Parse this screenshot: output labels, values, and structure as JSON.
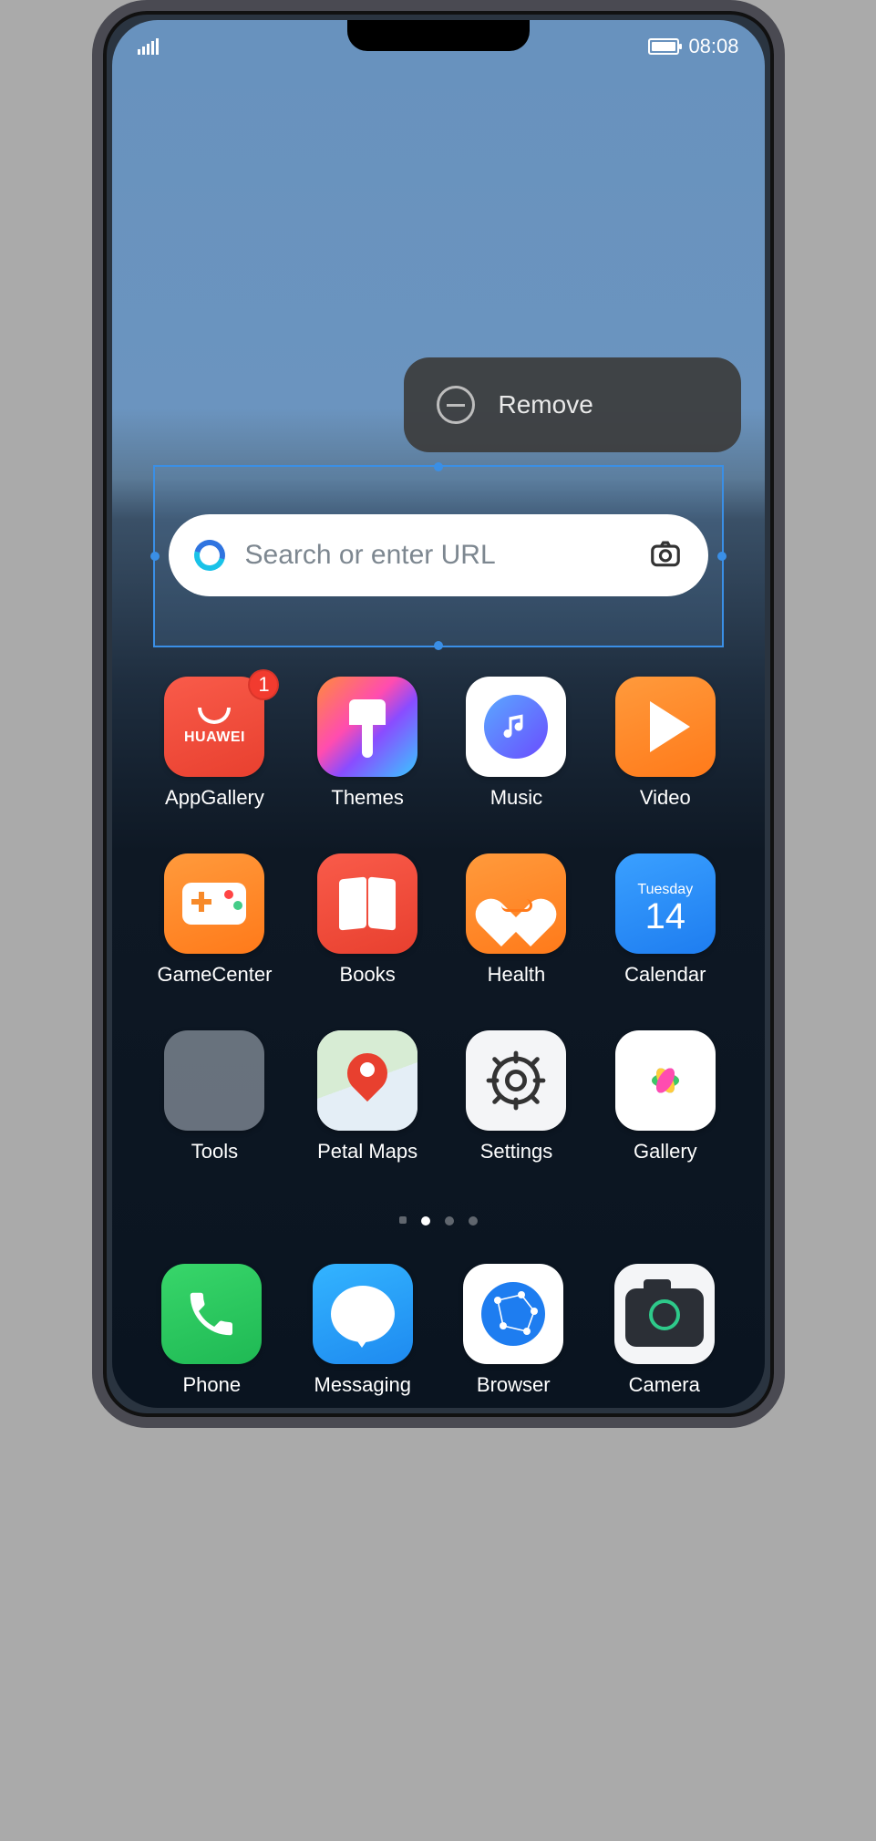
{
  "status": {
    "time": "08:08"
  },
  "popup": {
    "remove_label": "Remove"
  },
  "search": {
    "placeholder": "Search or enter URL"
  },
  "apps": {
    "row1": [
      {
        "label": "AppGallery",
        "badge": "1",
        "brand": "HUAWEI"
      },
      {
        "label": "Themes"
      },
      {
        "label": "Music"
      },
      {
        "label": "Video"
      }
    ],
    "row2": [
      {
        "label": "GameCenter"
      },
      {
        "label": "Books"
      },
      {
        "label": "Health"
      },
      {
        "label": "Calendar",
        "dow": "Tuesday",
        "dnum": "14"
      }
    ],
    "row3": [
      {
        "label": "Tools"
      },
      {
        "label": "Petal Maps"
      },
      {
        "label": "Settings"
      },
      {
        "label": "Gallery"
      }
    ]
  },
  "dock": [
    {
      "label": "Phone"
    },
    {
      "label": "Messaging"
    },
    {
      "label": "Browser"
    },
    {
      "label": "Camera"
    }
  ],
  "pager": {
    "total": 4,
    "active_index": 1
  }
}
